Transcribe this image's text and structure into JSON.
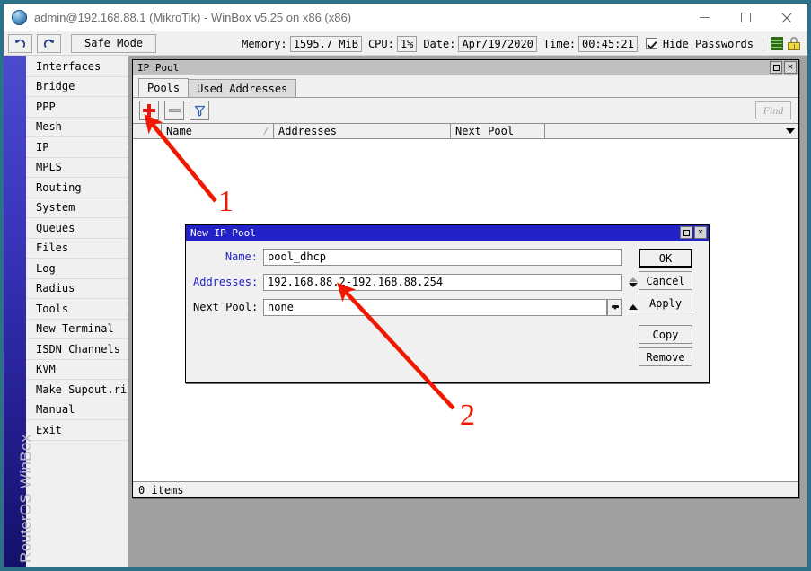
{
  "window": {
    "title": "admin@192.168.88.1 (MikroTik) - WinBox v5.25 on x86 (x86)",
    "logo_icon": "winbox-globe-icon",
    "minimize_icon": "minimize-icon",
    "maximize_icon": "maximize-icon",
    "close_icon": "close-icon"
  },
  "toolbar": {
    "undo_icon": "undo-arrow-icon",
    "redo_icon": "redo-arrow-icon",
    "safe_mode_label": "Safe Mode"
  },
  "status": {
    "memory_label": "Memory:",
    "memory_value": "1595.7 MiB",
    "cpu_label": "CPU:",
    "cpu_value": "1%",
    "date_label": "Date:",
    "date_value": "Apr/19/2020",
    "time_label": "Time:",
    "time_value": "00:45:21",
    "hide_passwords_label": "Hide Passwords",
    "hide_passwords_checked": true,
    "session_icon": "green-bars-icon",
    "secure_icon": "padlock-icon"
  },
  "sidebar": {
    "brand": "RouterOS WinBox",
    "items": [
      {
        "label": "Interfaces",
        "submenu": false
      },
      {
        "label": "Bridge",
        "submenu": false
      },
      {
        "label": "PPP",
        "submenu": false
      },
      {
        "label": "Mesh",
        "submenu": false
      },
      {
        "label": "IP",
        "submenu": true
      },
      {
        "label": "MPLS",
        "submenu": true
      },
      {
        "label": "Routing",
        "submenu": true
      },
      {
        "label": "System",
        "submenu": true
      },
      {
        "label": "Queues",
        "submenu": false
      },
      {
        "label": "Files",
        "submenu": false
      },
      {
        "label": "Log",
        "submenu": false
      },
      {
        "label": "Radius",
        "submenu": false
      },
      {
        "label": "Tools",
        "submenu": true
      },
      {
        "label": "New Terminal",
        "submenu": false
      },
      {
        "label": "ISDN Channels",
        "submenu": false
      },
      {
        "label": "KVM",
        "submenu": false
      },
      {
        "label": "Make Supout.rif",
        "submenu": false
      },
      {
        "label": "Manual",
        "submenu": false
      },
      {
        "label": "Exit",
        "submenu": false
      }
    ]
  },
  "ip_pool_window": {
    "title": "IP Pool",
    "maximize_icon": "restore-icon",
    "close_icon": "close-icon",
    "tabs": [
      {
        "label": "Pools",
        "active": true
      },
      {
        "label": "Used Addresses",
        "active": false
      }
    ],
    "toolbar": {
      "add_icon": "plus-icon",
      "remove_icon": "minus-icon",
      "filter_icon": "funnel-icon",
      "find_placeholder": "Find"
    },
    "table": {
      "columns": [
        "Name",
        "Addresses",
        "Next Pool",
        ""
      ],
      "sort_indicator": "/",
      "dropdown_icon": "chevron-down-icon",
      "rows": []
    },
    "status_text": "0 items"
  },
  "new_pool_dialog": {
    "title": "New IP Pool",
    "maximize_icon": "restore-icon",
    "close_icon": "close-icon",
    "fields": [
      {
        "label": "Name:",
        "value": "pool_dhcp",
        "label_color": "#2222c8"
      },
      {
        "label": "Addresses:",
        "value": "192.168.88.2-192.168.88.254",
        "label_color": "#2222c8"
      },
      {
        "label": "Next Pool:",
        "value": "none",
        "label_color": "#000000"
      }
    ],
    "buttons": [
      {
        "label": "OK",
        "default": true
      },
      {
        "label": "Cancel",
        "default": false
      },
      {
        "label": "Apply",
        "default": false
      },
      {
        "label": "Copy",
        "default": false
      },
      {
        "label": "Remove",
        "default": false
      }
    ]
  },
  "annotations": [
    {
      "number": "1",
      "points_to": "add-pool-button"
    },
    {
      "number": "2",
      "points_to": "addresses-field"
    }
  ],
  "colors": {
    "desktop": "#a0a0a0",
    "window_frame": "#2b7289",
    "accent_blue": "#2222c8",
    "annotation_red": "#f01800",
    "sidebar_gradient_top": "#4b4bd0",
    "sidebar_gradient_bottom": "#14116a"
  }
}
